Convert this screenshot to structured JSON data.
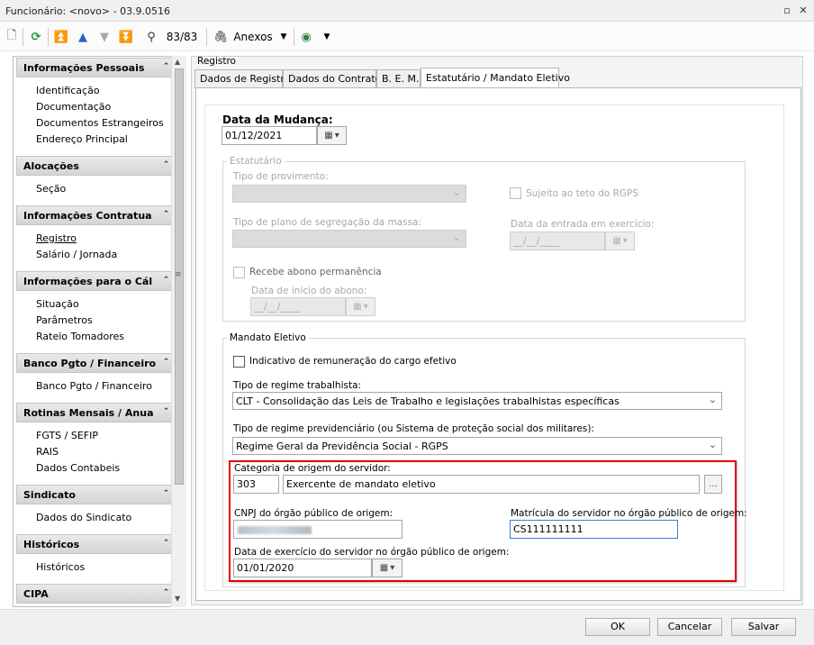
{
  "window": {
    "title": "Funcionário: <novo> - 03.9.0516"
  },
  "toolbar": {
    "record_counter": "83/83",
    "attachments_label": "Anexos"
  },
  "sidebar": {
    "sections": [
      {
        "title": "Informações Pessoais",
        "items": [
          "Identificação",
          "Documentação",
          "Documentos Estrangeiros",
          "Endereço Principal"
        ]
      },
      {
        "title": "Alocações",
        "items": [
          "Seção"
        ]
      },
      {
        "title": "Informações Contratua",
        "items": [
          "Registro",
          "Salário / Jornada"
        ]
      },
      {
        "title": "Informações para o Cál",
        "items": [
          "Situação",
          "Parâmetros",
          "Rateio Tomadores"
        ]
      },
      {
        "title": "Banco Pgto / Financeiro",
        "items": [
          "Banco Pgto / Financeiro"
        ]
      },
      {
        "title": "Rotinas Mensais / Anua",
        "items": [
          "FGTS / SEFIP",
          "RAIS",
          "Dados Contabeis"
        ]
      },
      {
        "title": "Sindicato",
        "items": [
          "Dados do Sindicato"
        ]
      },
      {
        "title": "Históricos",
        "items": [
          "Históricos"
        ]
      },
      {
        "title": "CIPA",
        "items": []
      }
    ]
  },
  "panel": {
    "group_title": "Registro",
    "tabs": [
      "Dados de Registro",
      "Dados do Contrato",
      "B. E. M.",
      "Estatutário / Mandato Eletivo"
    ]
  },
  "form": {
    "data_mudanca_label": "Data da Mudança:",
    "data_mudanca_value": "01/12/2021",
    "estatutario": {
      "title": "Estatutário",
      "tipo_provimento_label": "Tipo de provimento:",
      "sujeito_teto_label": "Sujeito ao teto do RGPS",
      "tipo_plano_label": "Tipo de plano de segregação da massa:",
      "data_entrada_label": "Data da entrada em exercício:",
      "data_entrada_value": "__/__/____",
      "recebe_abono_label": "Recebe abono permanência",
      "data_inicio_abono_label": "Data de início do abono:",
      "data_inicio_abono_value": "__/__/____"
    },
    "mandato": {
      "title": "Mandato Eletivo",
      "indicativo_label": "Indicativo de remuneração do cargo efetivo",
      "tipo_regime_trab_label": "Tipo de regime trabalhista:",
      "tipo_regime_trab_value": "CLT - Consolidação das Leis de Trabalho e legislações trabalhistas específicas",
      "tipo_regime_prev_label": "Tipo de regime previdenciário (ou Sistema de proteção social dos militares):",
      "tipo_regime_prev_value": "Regime Geral da Previdência Social - RGPS",
      "categoria_label": "Categoria de origem do servidor:",
      "categoria_code": "303",
      "categoria_desc": "Exercente de mandato eletivo",
      "lookup_label": "...",
      "cnpj_label": "CNPJ do órgão público de origem:",
      "matricula_label": "Matrícula do servidor no órgão público de origem:",
      "matricula_value": "CS111111111",
      "data_exercicio_label": "Data de exercício do servidor no órgão público de origem:",
      "data_exercicio_value": "01/01/2020"
    }
  },
  "buttons": {
    "ok": "OK",
    "cancel": "Cancelar",
    "save": "Salvar"
  }
}
